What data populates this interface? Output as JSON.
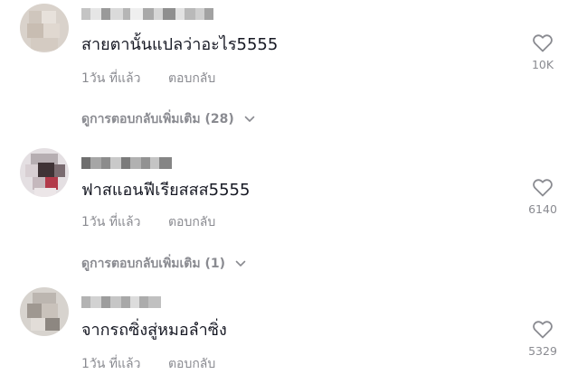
{
  "comments": [
    {
      "text": "สายตานั้นแปลว่าอะไร5555",
      "time": "1วัน ที่แล้ว",
      "reply": "ตอบกลับ",
      "likes": "10K",
      "view_replies": "ดูการตอบกลับเพิ่มเติม (28)"
    },
    {
      "text": "ฟาสแอนฟีเรียสสส5555",
      "time": "1วัน ที่แล้ว",
      "reply": "ตอบกลับ",
      "likes": "6140",
      "view_replies": "ดูการตอบกลับเพิ่มเติม (1)"
    },
    {
      "text": "จากรถซิ่งสู่หมอลำซิ่ง",
      "time": "1วัน ที่แล้ว",
      "reply": "ตอบกลับ",
      "likes": "5329"
    }
  ],
  "icons": {
    "like": "heart-outline-icon",
    "expand": "chevron-down-icon"
  },
  "colors": {
    "primary_text": "#161823",
    "secondary_text": "#8a8b91",
    "background": "#ffffff"
  }
}
